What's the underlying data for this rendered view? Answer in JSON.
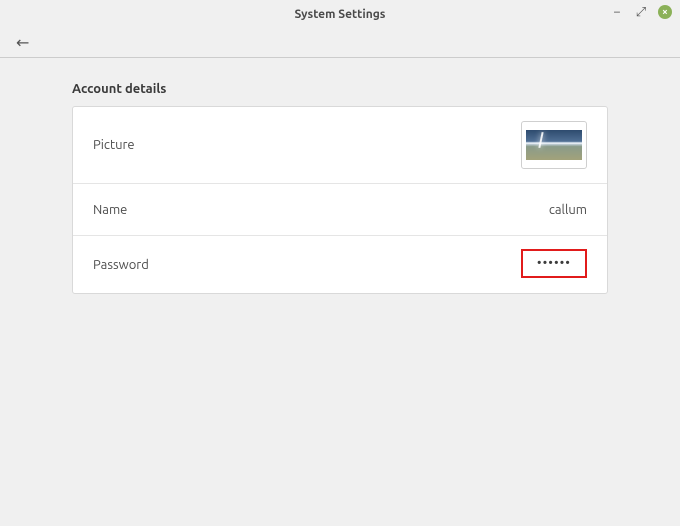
{
  "window": {
    "title": "System Settings"
  },
  "icons": {
    "minimize": "−",
    "maximize": "⤢",
    "close": "×",
    "back": "←"
  },
  "section": {
    "title": "Account details",
    "rows": {
      "picture": {
        "label": "Picture"
      },
      "name": {
        "label": "Name",
        "value": "callum"
      },
      "password": {
        "label": "Password",
        "value": "••••••"
      }
    }
  }
}
